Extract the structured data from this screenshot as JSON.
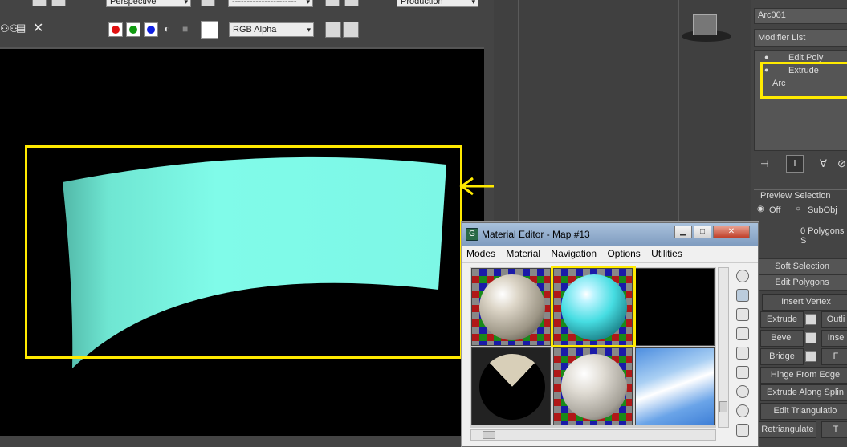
{
  "render_window": {
    "view_dropdown": "Perspective",
    "preset_dropdown": "----------------------",
    "renderer_dropdown": "Production",
    "channel_dropdown": "RGB Alpha"
  },
  "command_panel": {
    "object_name": "Arc001",
    "modifier_list_label": "Modifier List",
    "stack": [
      "Edit Poly",
      "Extrude",
      "Arc"
    ],
    "preview_selection": {
      "title": "Preview Selection",
      "options": [
        "Off",
        "SubObj"
      ],
      "selected": "Off"
    },
    "polygons_status": "0 Polygons S",
    "soft_selection_label": "Soft Selection",
    "edit_polygons_label": "Edit Polygons",
    "buttons": {
      "insert_vertex": "Insert Vertex",
      "extrude": "Extrude",
      "outline": "Outli",
      "bevel": "Bevel",
      "inset": "Inse",
      "bridge": "Bridge",
      "flip": "F",
      "hinge": "Hinge From Edge",
      "extrude_spline": "Extrude Along Splin",
      "edit_tri": "Edit Triangulatio",
      "retriangulate": "Retriangulate",
      "turn": "T"
    }
  },
  "material_editor": {
    "title": "Material Editor - Map #13",
    "menu": [
      "Modes",
      "Material",
      "Navigation",
      "Options",
      "Utilities"
    ]
  },
  "colors": {
    "highlight": "#ffea00",
    "surface": "#7ffbe8",
    "viewport_bg": "#000000"
  }
}
